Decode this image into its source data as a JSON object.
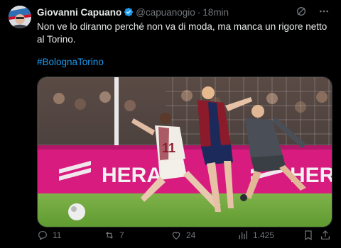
{
  "tweet": {
    "author_name": "Giovanni Capuano",
    "handle": "@capuanogio",
    "separator": "·",
    "time": "18min",
    "text": "Non ve lo diranno perché non va di moda, ma manca un rigore netto al Torino.",
    "hashtag": "#BolognaTorino",
    "media": {
      "ad_board_text_1": "HERA",
      "ad_board_text_2": "HERA",
      "player_number": "11"
    }
  },
  "actions": {
    "replies": "11",
    "retweets": "7",
    "likes": "24",
    "views": "1.425"
  },
  "colors": {
    "background": "#000000",
    "text": "#e7e9ea",
    "muted": "#71767b",
    "accent": "#1d9bf0"
  },
  "icons": {
    "verified": "verified-badge-icon",
    "grok": "grok-icon",
    "more": "more-icon",
    "reply": "reply-icon",
    "retweet": "retweet-icon",
    "like": "heart-icon",
    "views": "views-icon",
    "bookmark": "bookmark-icon",
    "share": "share-icon"
  }
}
